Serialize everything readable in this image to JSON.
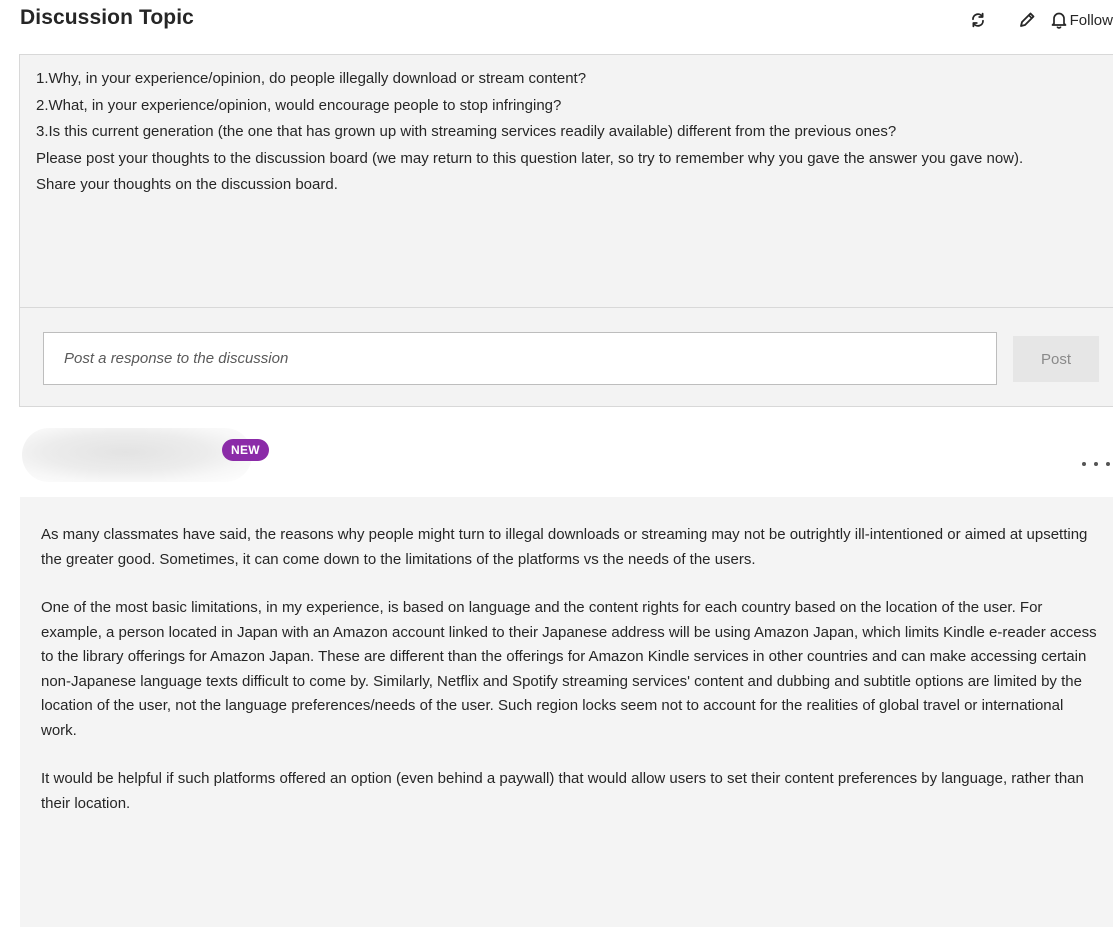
{
  "header": {
    "title": "Discussion Topic",
    "actions": {
      "refresh_icon": "refresh-icon",
      "edit_icon": "pencil-icon",
      "follow_icon": "bell-icon",
      "follow_label": "Follow"
    }
  },
  "topic": {
    "paragraphs": [
      "1.Why, in your experience/opinion, do people illegally download or stream content?",
      "2.What, in your experience/opinion, would encourage people to stop infringing?",
      "3.Is this current generation (the one that has grown up with streaming services readily available) different from the previous ones?",
      "Please post your thoughts to the discussion board (we may return to this question later, so try to remember why you gave the answer you gave now).",
      "Share your thoughts on the discussion board."
    ],
    "response_placeholder": "Post a response to the discussion",
    "post_label": "Post"
  },
  "reply": {
    "badge": "NEW",
    "more_icon": "more-horizontal-icon",
    "paragraphs": [
      "As many classmates have said, the reasons why people might turn to illegal downloads or streaming may not be outrightly ill-intentioned or aimed at upsetting the greater good. Sometimes, it can come down to the limitations of the platforms vs the needs of the users.",
      "One of the most basic limitations, in my experience, is based on language and the content rights for each country based on the location of the user. For example, a person located in Japan with an Amazon account linked to their Japanese address will be using Amazon Japan, which limits Kindle e-reader access to the library offerings for Amazon Japan. These are different than the offerings for Amazon Kindle services in other countries and can make accessing certain non-Japanese language texts difficult to come by. Similarly, Netflix and Spotify streaming services' content and dubbing and subtitle options are limited by the location of the user, not the language preferences/needs of the user. Such region locks seem not to account for the realities of global travel or international work.",
      "It would be helpful if such platforms offered an option (even behind a paywall) that would allow users to set their content preferences by language, rather than their location."
    ]
  },
  "colors": {
    "badge": "#8b2ba8",
    "panel_background": "#f3f3f3",
    "text": "#262626"
  }
}
